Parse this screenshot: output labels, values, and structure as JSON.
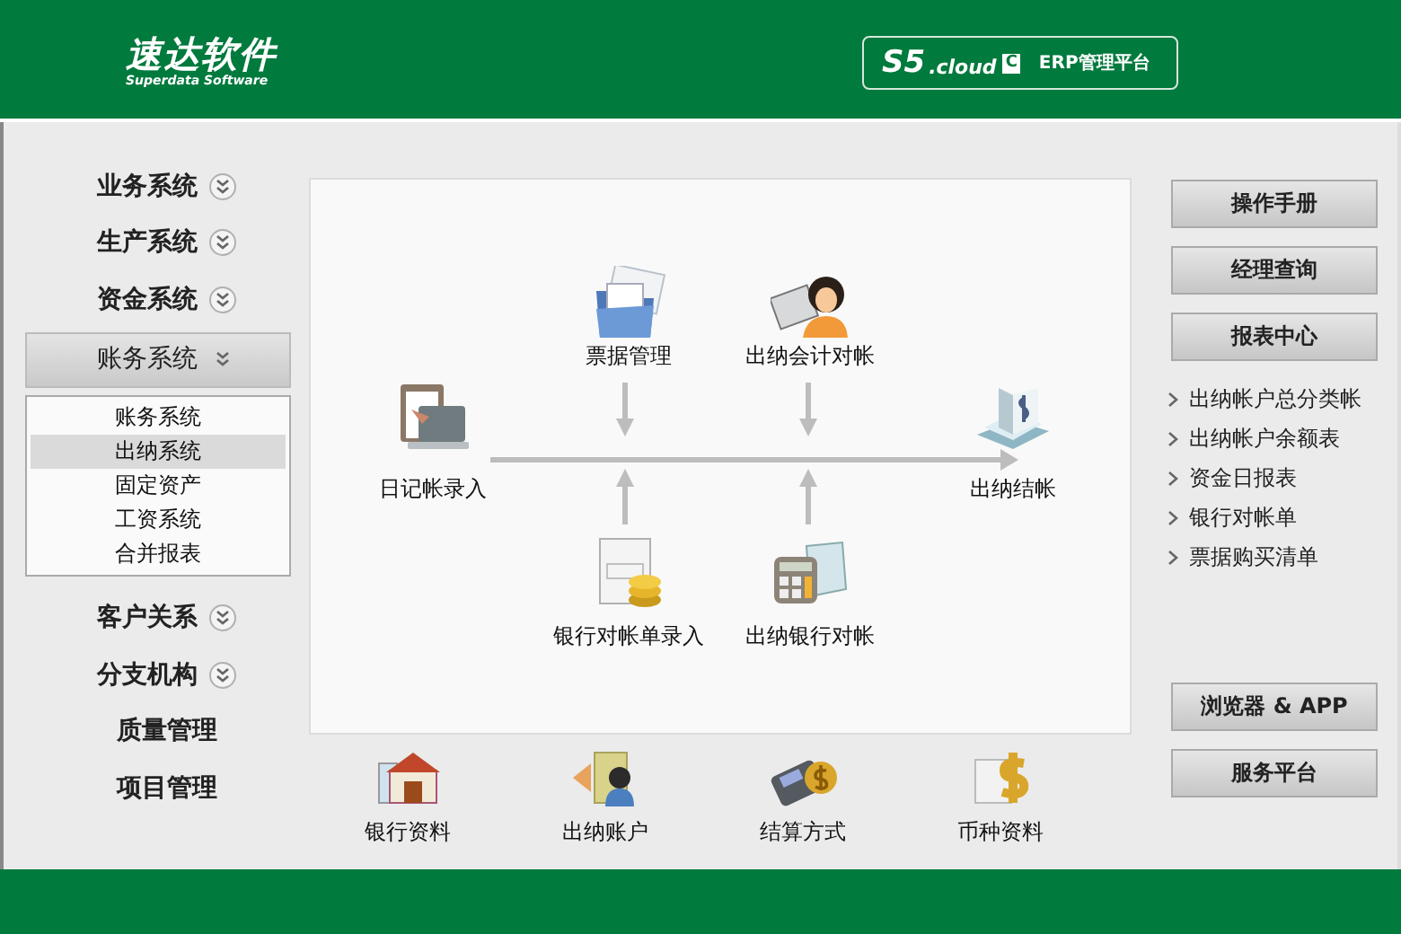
{
  "header": {
    "logo_title": "速达软件",
    "logo_subtitle": "Superdata Software",
    "badge": {
      "product": "S5",
      "suffix": ".cloud",
      "mark": "C",
      "platform": "ERP管理平台"
    }
  },
  "sidebar": {
    "items": [
      {
        "label": "业务系统",
        "expandable": true,
        "selected": false
      },
      {
        "label": "生产系统",
        "expandable": true,
        "selected": false
      },
      {
        "label": "资金系统",
        "expandable": true,
        "selected": false
      },
      {
        "label": "账务系统",
        "expandable": true,
        "selected": true,
        "children": [
          {
            "label": "账务系统",
            "selected": false
          },
          {
            "label": "出纳系统",
            "selected": true
          },
          {
            "label": "固定资产",
            "selected": false
          },
          {
            "label": "工资系统",
            "selected": false
          },
          {
            "label": "合并报表",
            "selected": false
          }
        ]
      },
      {
        "label": "客户关系",
        "expandable": true,
        "selected": false
      },
      {
        "label": "分支机构",
        "expandable": true,
        "selected": false
      },
      {
        "label": "质量管理",
        "expandable": false,
        "selected": false
      },
      {
        "label": "项目管理",
        "expandable": false,
        "selected": false
      }
    ]
  },
  "flow": {
    "nodes": [
      {
        "label": "日记帐录入"
      },
      {
        "label": "票据管理"
      },
      {
        "label": "出纳会计对帐"
      },
      {
        "label": "出纳结帐"
      },
      {
        "label": "银行对帐单录入"
      },
      {
        "label": "出纳银行对帐"
      }
    ]
  },
  "shortcuts": [
    {
      "label": "银行资料"
    },
    {
      "label": "出纳账户"
    },
    {
      "label": "结算方式"
    },
    {
      "label": "币种资料"
    }
  ],
  "right_panel": {
    "top_buttons": [
      "操作手册",
      "经理查询",
      "报表中心"
    ],
    "reports": [
      "出纳帐户总分类帐",
      "出纳帐户余额表",
      "资金日报表",
      "银行对帐单",
      "票据购买清单"
    ],
    "bottom_buttons": [
      "浏览器 & APP",
      "服务平台"
    ]
  }
}
